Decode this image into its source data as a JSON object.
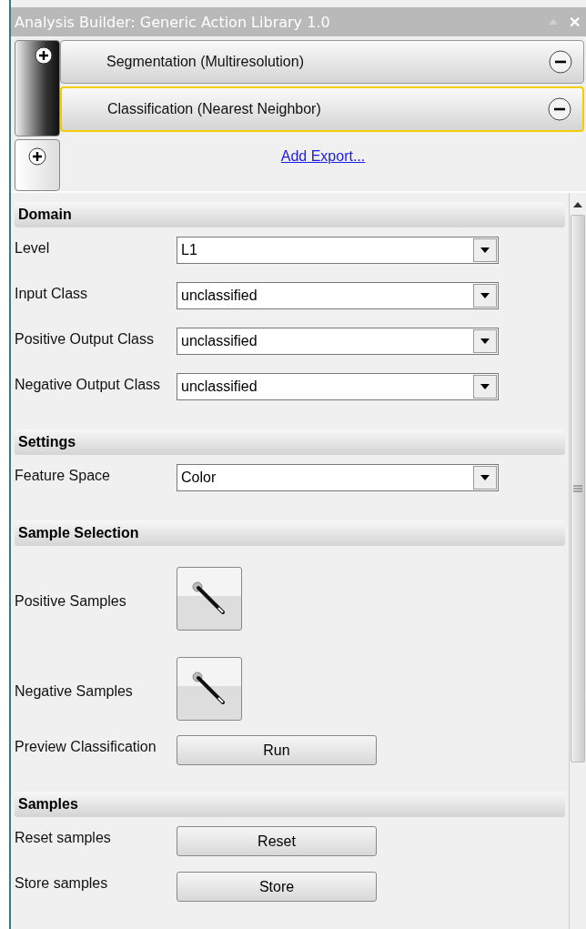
{
  "window": {
    "title": "Analysis Builder: Generic Action Library 1.0",
    "close": "✕"
  },
  "actions": [
    {
      "label": "Segmentation (Multiresolution)",
      "selected": false
    },
    {
      "label": "Classification (Nearest Neighbor)",
      "selected": true
    }
  ],
  "add_export": "Add Export...",
  "sections": [
    {
      "title": "Domain",
      "rows": [
        {
          "kind": "dropdown",
          "label": "Level",
          "value": "L1"
        },
        {
          "kind": "dropdown",
          "label": "Input Class",
          "value": "unclassified"
        },
        {
          "kind": "dropdown",
          "label": "Positive Output Class",
          "value": "unclassified"
        },
        {
          "kind": "dropdown",
          "label": "Negative Output Class",
          "value": "unclassified"
        }
      ]
    },
    {
      "title": "Settings",
      "rows": [
        {
          "kind": "dropdown",
          "label": "Feature Space",
          "value": "Color"
        }
      ]
    },
    {
      "title": "Sample Selection",
      "rows": [
        {
          "kind": "tool",
          "label": "Positive Samples"
        },
        {
          "kind": "tool",
          "label": "Negative Samples"
        },
        {
          "kind": "button",
          "label": "Preview Classification",
          "button": "Run"
        }
      ]
    },
    {
      "title": "Samples",
      "rows": [
        {
          "kind": "button",
          "label": "Reset samples",
          "button": "Reset"
        },
        {
          "kind": "button",
          "label": "Store samples",
          "button": "Store"
        }
      ]
    }
  ]
}
